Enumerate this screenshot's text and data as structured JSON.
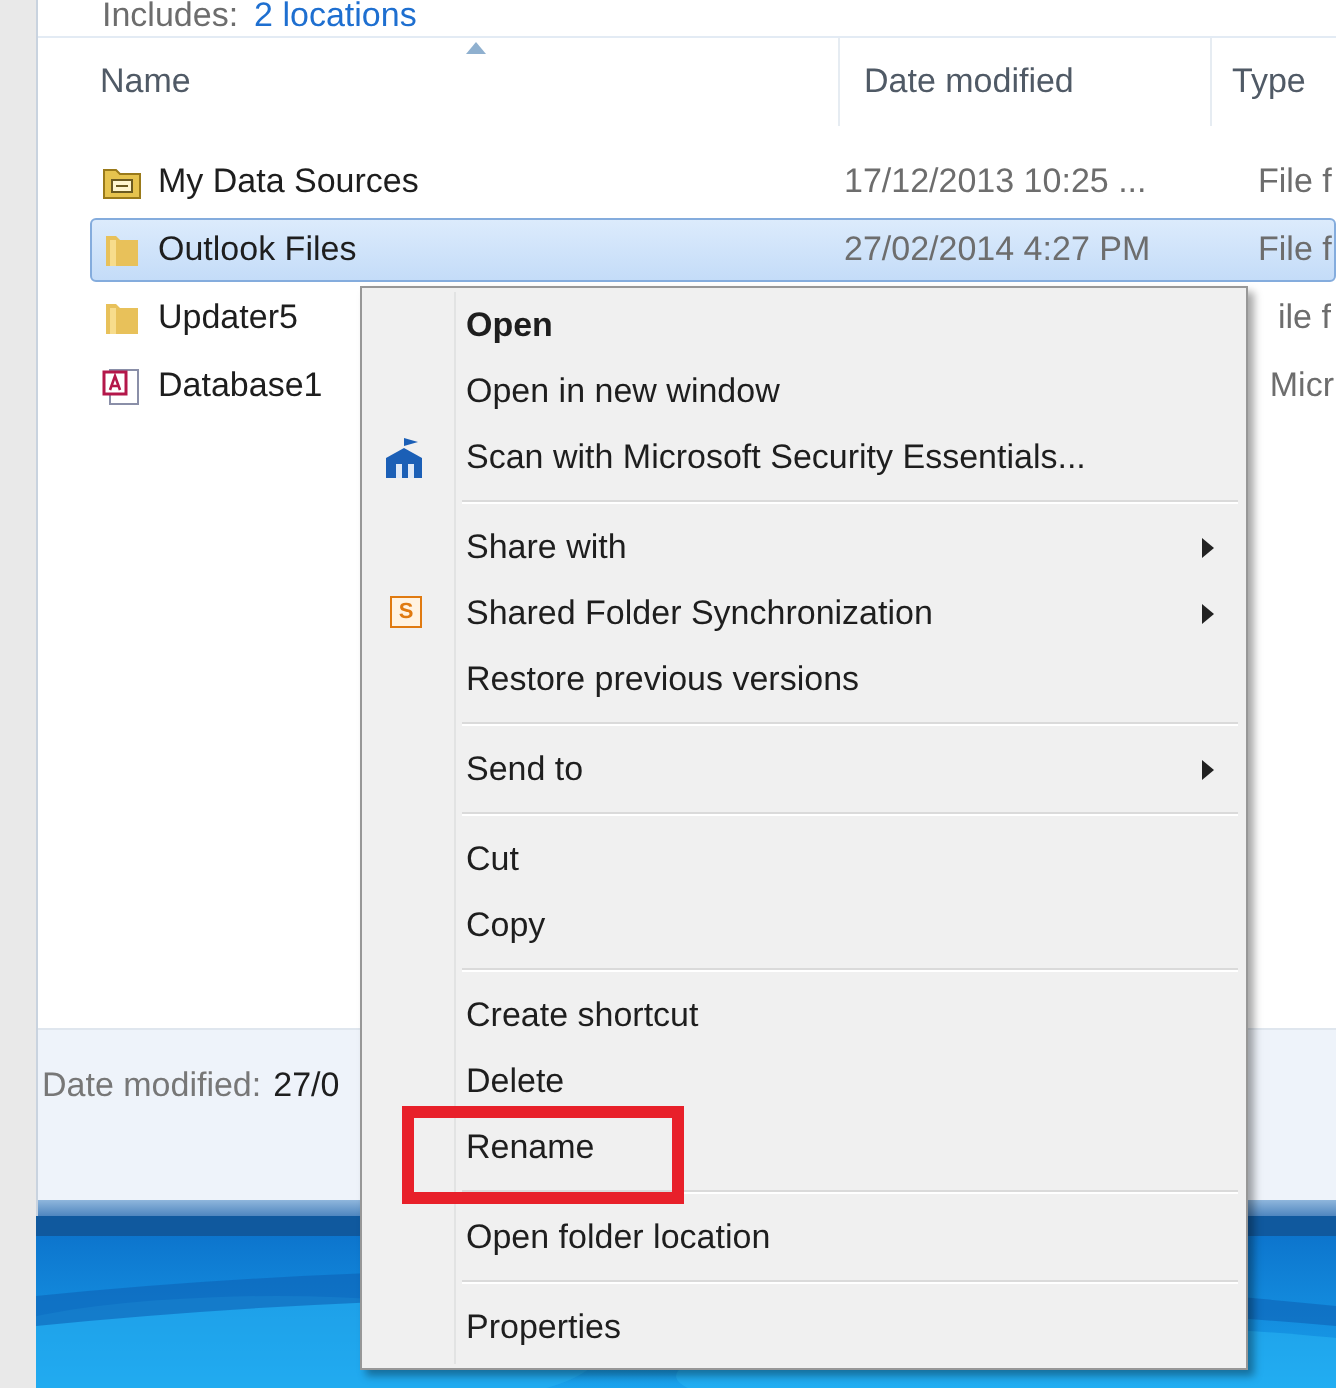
{
  "library": {
    "includes_label": "Includes:",
    "includes_link": "2 locations"
  },
  "columns": [
    {
      "label": "Name"
    },
    {
      "label": "Date modified"
    },
    {
      "label": "Type"
    }
  ],
  "rows": [
    {
      "name": "My Data Sources",
      "kind": "datafolder",
      "date": "17/12/2013 10:25 ...",
      "type": "File f",
      "selected": false
    },
    {
      "name": "Outlook Files",
      "kind": "folder",
      "date": "27/02/2014 4:27 PM",
      "type": "File f",
      "selected": true
    },
    {
      "name": "Updater5",
      "kind": "folder",
      "type": "ile f",
      "selected": false
    },
    {
      "name": "Database1",
      "kind": "database",
      "type": "Micr",
      "selected": false
    }
  ],
  "details": {
    "label": "Date modified:",
    "value": "27/0"
  },
  "context_menu": {
    "items": [
      {
        "kind": "plain",
        "label": "Open",
        "bold": true,
        "submenu": false,
        "annotated": false
      },
      {
        "kind": "plain",
        "label": "Open in new window",
        "bold": false,
        "submenu": false,
        "annotated": false
      },
      {
        "kind": "scan",
        "label": "Scan with Microsoft Security Essentials...",
        "bold": false,
        "submenu": false,
        "annotated": false
      },
      {
        "kind": "separator"
      },
      {
        "kind": "plain",
        "label": "Share with",
        "bold": false,
        "submenu": true,
        "annotated": false
      },
      {
        "kind": "sync",
        "label": "Shared Folder Synchronization",
        "bold": false,
        "submenu": true,
        "annotated": false,
        "icon_text": "S"
      },
      {
        "kind": "plain",
        "label": "Restore previous versions",
        "bold": false,
        "submenu": false,
        "annotated": false
      },
      {
        "kind": "separator"
      },
      {
        "kind": "plain",
        "label": "Send to",
        "bold": false,
        "submenu": true,
        "annotated": false
      },
      {
        "kind": "separator"
      },
      {
        "kind": "plain",
        "label": "Cut",
        "bold": false,
        "submenu": false,
        "annotated": false
      },
      {
        "kind": "plain",
        "label": "Copy",
        "bold": false,
        "submenu": false,
        "annotated": false
      },
      {
        "kind": "separator"
      },
      {
        "kind": "plain",
        "label": "Create shortcut",
        "bold": false,
        "submenu": false,
        "annotated": false
      },
      {
        "kind": "plain",
        "label": "Delete",
        "bold": false,
        "submenu": false,
        "annotated": false
      },
      {
        "kind": "plain",
        "label": "Rename",
        "bold": false,
        "submenu": false,
        "annotated": true
      },
      {
        "kind": "separator"
      },
      {
        "kind": "plain",
        "label": "Open folder location",
        "bold": false,
        "submenu": false,
        "annotated": false
      },
      {
        "kind": "separator"
      },
      {
        "kind": "plain",
        "label": "Properties",
        "bold": false,
        "submenu": false,
        "annotated": false
      }
    ]
  }
}
